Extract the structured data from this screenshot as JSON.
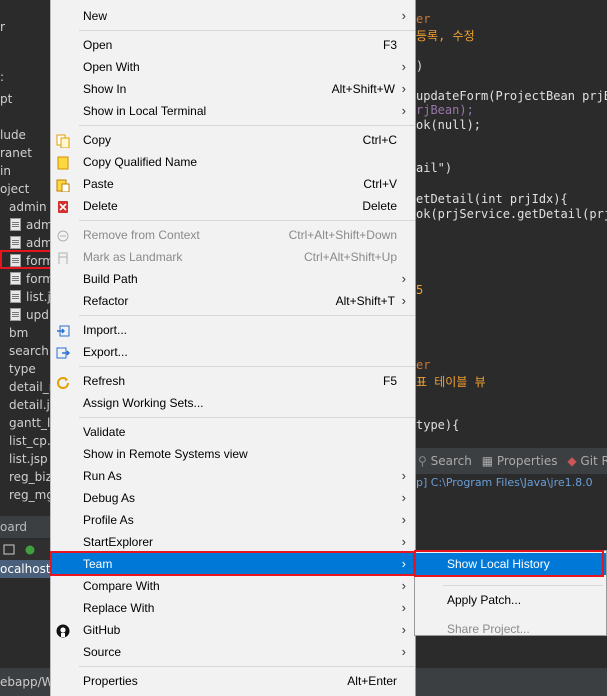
{
  "left_tree": [
    {
      "label": "r",
      "icon": false
    },
    {
      "label": ":",
      "icon": false
    },
    {
      "label": "pt",
      "icon": false
    },
    {
      "label": "lude",
      "icon": false
    },
    {
      "label": "ranet",
      "icon": false
    },
    {
      "label": "in",
      "icon": false
    },
    {
      "label": "oject",
      "icon": false
    },
    {
      "label": "admin",
      "icon": false
    },
    {
      "label": "adm",
      "icon": true
    },
    {
      "label": "adm",
      "icon": true
    },
    {
      "label": "form",
      "icon": true
    },
    {
      "label": "form",
      "icon": true
    },
    {
      "label": "list.j",
      "icon": true
    },
    {
      "label": "upd",
      "icon": true
    },
    {
      "label": "bm",
      "icon": false
    },
    {
      "label": "search",
      "icon": false
    },
    {
      "label": "type",
      "icon": false
    },
    {
      "label": "detail_m",
      "icon": false
    },
    {
      "label": "detail.js",
      "icon": false
    },
    {
      "label": "gantt_li",
      "icon": false
    },
    {
      "label": "list_cp.j",
      "icon": false
    },
    {
      "label": "list.jsp",
      "icon": false
    },
    {
      "label": "reg_biz",
      "icon": false
    },
    {
      "label": "reg_mg",
      "icon": false
    }
  ],
  "left_bottom": {
    "tab_label": "oard",
    "server_label": "ocalhost"
  },
  "status_bar": {
    "text": "ebapp/W"
  },
  "code_lines": [
    {
      "text": "er",
      "color": "#cc7832"
    },
    {
      "text": "등록, 수정",
      "color": "#f0a030"
    },
    {
      "text": ")",
      "color": "#e0e0e0"
    },
    {
      "text": "updateForm(ProjectBean prjBe",
      "color": "#e0e0e0"
    },
    {
      "text": "rjBean);",
      "color": "#9876aa"
    },
    {
      "text": "ok(null);",
      "color": "#e0e0e0"
    },
    {
      "text": "ail\")",
      "color": "#e0e0e0"
    },
    {
      "text": "etDetail(int prjIdx){",
      "color": "#e0e0e0"
    },
    {
      "text": "ok(prjService.getDetail(prj",
      "color": "#e0e0e0"
    },
    {
      "text": "5",
      "color": "#f0a030"
    },
    {
      "text": "er",
      "color": "#cc7832"
    },
    {
      "text": "표 테이블 뷰",
      "color": "#f0a030"
    },
    {
      "text": "type){",
      "color": "#e0e0e0"
    }
  ],
  "right_tabs": [
    "Search",
    "Properties",
    "Git R"
  ],
  "console_text": "p] C:\\Program Files\\Java\\jre1.8.0",
  "context_menu": {
    "items": [
      {
        "type": "item",
        "label": "New",
        "shortcut": "",
        "submenu": true,
        "disabled": false,
        "icon": "",
        "selected": false
      },
      {
        "type": "sep"
      },
      {
        "type": "item",
        "label": "Open",
        "shortcut": "F3",
        "submenu": false,
        "disabled": false,
        "icon": "",
        "selected": false
      },
      {
        "type": "item",
        "label": "Open With",
        "shortcut": "",
        "submenu": true,
        "disabled": false,
        "icon": "",
        "selected": false
      },
      {
        "type": "item",
        "label": "Show In",
        "shortcut": "Alt+Shift+W",
        "submenu": true,
        "disabled": false,
        "icon": "",
        "selected": false
      },
      {
        "type": "item",
        "label": "Show in Local Terminal",
        "shortcut": "",
        "submenu": true,
        "disabled": false,
        "icon": "",
        "selected": false
      },
      {
        "type": "sep"
      },
      {
        "type": "item",
        "label": "Copy",
        "shortcut": "Ctrl+C",
        "submenu": false,
        "disabled": false,
        "icon": "copy-icon",
        "selected": false
      },
      {
        "type": "item",
        "label": "Copy Qualified Name",
        "shortcut": "",
        "submenu": false,
        "disabled": false,
        "icon": "copy-qualified-icon",
        "selected": false
      },
      {
        "type": "item",
        "label": "Paste",
        "shortcut": "Ctrl+V",
        "submenu": false,
        "disabled": false,
        "icon": "paste-icon",
        "selected": false
      },
      {
        "type": "item",
        "label": "Delete",
        "shortcut": "Delete",
        "submenu": false,
        "disabled": false,
        "icon": "delete-icon",
        "selected": false
      },
      {
        "type": "sep"
      },
      {
        "type": "item",
        "label": "Remove from Context",
        "shortcut": "Ctrl+Alt+Shift+Down",
        "submenu": false,
        "disabled": true,
        "icon": "remove-context-icon",
        "selected": false
      },
      {
        "type": "item",
        "label": "Mark as Landmark",
        "shortcut": "Ctrl+Alt+Shift+Up",
        "submenu": false,
        "disabled": true,
        "icon": "landmark-icon",
        "selected": false
      },
      {
        "type": "item",
        "label": "Build Path",
        "shortcut": "",
        "submenu": true,
        "disabled": false,
        "icon": "",
        "selected": false
      },
      {
        "type": "item",
        "label": "Refactor",
        "shortcut": "Alt+Shift+T",
        "submenu": true,
        "disabled": false,
        "icon": "",
        "selected": false
      },
      {
        "type": "sep"
      },
      {
        "type": "item",
        "label": "Import...",
        "shortcut": "",
        "submenu": false,
        "disabled": false,
        "icon": "import-icon",
        "selected": false
      },
      {
        "type": "item",
        "label": "Export...",
        "shortcut": "",
        "submenu": false,
        "disabled": false,
        "icon": "export-icon",
        "selected": false
      },
      {
        "type": "sep"
      },
      {
        "type": "item",
        "label": "Refresh",
        "shortcut": "F5",
        "submenu": false,
        "disabled": false,
        "icon": "refresh-icon",
        "selected": false
      },
      {
        "type": "item",
        "label": "Assign Working Sets...",
        "shortcut": "",
        "submenu": false,
        "disabled": false,
        "icon": "",
        "selected": false
      },
      {
        "type": "sep"
      },
      {
        "type": "item",
        "label": "Validate",
        "shortcut": "",
        "submenu": false,
        "disabled": false,
        "icon": "",
        "selected": false
      },
      {
        "type": "item",
        "label": "Show in Remote Systems view",
        "shortcut": "",
        "submenu": false,
        "disabled": false,
        "icon": "",
        "selected": false
      },
      {
        "type": "item",
        "label": "Run As",
        "shortcut": "",
        "submenu": true,
        "disabled": false,
        "icon": "",
        "selected": false
      },
      {
        "type": "item",
        "label": "Debug As",
        "shortcut": "",
        "submenu": true,
        "disabled": false,
        "icon": "",
        "selected": false
      },
      {
        "type": "item",
        "label": "Profile As",
        "shortcut": "",
        "submenu": true,
        "disabled": false,
        "icon": "",
        "selected": false
      },
      {
        "type": "item",
        "label": "StartExplorer",
        "shortcut": "",
        "submenu": true,
        "disabled": false,
        "icon": "",
        "selected": false
      },
      {
        "type": "item",
        "label": "Team",
        "shortcut": "",
        "submenu": true,
        "disabled": false,
        "icon": "",
        "selected": true
      },
      {
        "type": "item",
        "label": "Compare With",
        "shortcut": "",
        "submenu": true,
        "disabled": false,
        "icon": "",
        "selected": false
      },
      {
        "type": "item",
        "label": "Replace With",
        "shortcut": "",
        "submenu": true,
        "disabled": false,
        "icon": "",
        "selected": false
      },
      {
        "type": "item",
        "label": "GitHub",
        "shortcut": "",
        "submenu": true,
        "disabled": false,
        "icon": "github-icon",
        "selected": false
      },
      {
        "type": "item",
        "label": "Source",
        "shortcut": "",
        "submenu": true,
        "disabled": false,
        "icon": "",
        "selected": false
      },
      {
        "type": "sep"
      },
      {
        "type": "item",
        "label": "Properties",
        "shortcut": "Alt+Enter",
        "submenu": false,
        "disabled": false,
        "icon": "",
        "selected": false
      }
    ]
  },
  "team_submenu": {
    "items": [
      {
        "type": "item",
        "label": "Show Local History",
        "disabled": false,
        "selected": true
      },
      {
        "type": "sep"
      },
      {
        "type": "item",
        "label": "Apply Patch...",
        "disabled": false,
        "selected": false
      },
      {
        "type": "item",
        "label": "Share Project...",
        "disabled": true,
        "selected": false
      }
    ]
  },
  "colors": {
    "accent": "#0078d7",
    "highlight_box": "#e8141e",
    "menu_bg": "#f2f2f2"
  }
}
